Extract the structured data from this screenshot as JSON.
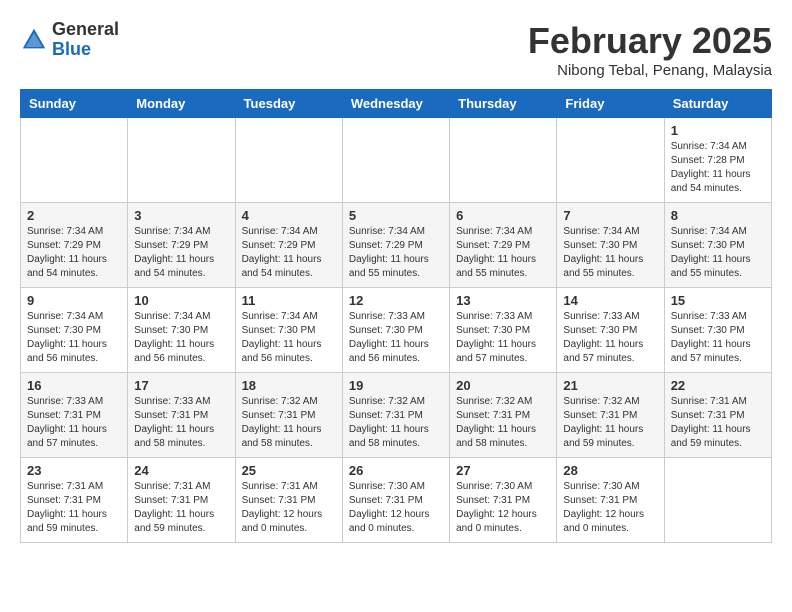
{
  "logo": {
    "general": "General",
    "blue": "Blue"
  },
  "title": "February 2025",
  "location": "Nibong Tebal, Penang, Malaysia",
  "days_of_week": [
    "Sunday",
    "Monday",
    "Tuesday",
    "Wednesday",
    "Thursday",
    "Friday",
    "Saturday"
  ],
  "weeks": [
    [
      {
        "day": "",
        "info": ""
      },
      {
        "day": "",
        "info": ""
      },
      {
        "day": "",
        "info": ""
      },
      {
        "day": "",
        "info": ""
      },
      {
        "day": "",
        "info": ""
      },
      {
        "day": "",
        "info": ""
      },
      {
        "day": "1",
        "info": "Sunrise: 7:34 AM\nSunset: 7:28 PM\nDaylight: 11 hours and 54 minutes."
      }
    ],
    [
      {
        "day": "2",
        "info": "Sunrise: 7:34 AM\nSunset: 7:29 PM\nDaylight: 11 hours and 54 minutes."
      },
      {
        "day": "3",
        "info": "Sunrise: 7:34 AM\nSunset: 7:29 PM\nDaylight: 11 hours and 54 minutes."
      },
      {
        "day": "4",
        "info": "Sunrise: 7:34 AM\nSunset: 7:29 PM\nDaylight: 11 hours and 54 minutes."
      },
      {
        "day": "5",
        "info": "Sunrise: 7:34 AM\nSunset: 7:29 PM\nDaylight: 11 hours and 55 minutes."
      },
      {
        "day": "6",
        "info": "Sunrise: 7:34 AM\nSunset: 7:29 PM\nDaylight: 11 hours and 55 minutes."
      },
      {
        "day": "7",
        "info": "Sunrise: 7:34 AM\nSunset: 7:30 PM\nDaylight: 11 hours and 55 minutes."
      },
      {
        "day": "8",
        "info": "Sunrise: 7:34 AM\nSunset: 7:30 PM\nDaylight: 11 hours and 55 minutes."
      }
    ],
    [
      {
        "day": "9",
        "info": "Sunrise: 7:34 AM\nSunset: 7:30 PM\nDaylight: 11 hours and 56 minutes."
      },
      {
        "day": "10",
        "info": "Sunrise: 7:34 AM\nSunset: 7:30 PM\nDaylight: 11 hours and 56 minutes."
      },
      {
        "day": "11",
        "info": "Sunrise: 7:34 AM\nSunset: 7:30 PM\nDaylight: 11 hours and 56 minutes."
      },
      {
        "day": "12",
        "info": "Sunrise: 7:33 AM\nSunset: 7:30 PM\nDaylight: 11 hours and 56 minutes."
      },
      {
        "day": "13",
        "info": "Sunrise: 7:33 AM\nSunset: 7:30 PM\nDaylight: 11 hours and 57 minutes."
      },
      {
        "day": "14",
        "info": "Sunrise: 7:33 AM\nSunset: 7:30 PM\nDaylight: 11 hours and 57 minutes."
      },
      {
        "day": "15",
        "info": "Sunrise: 7:33 AM\nSunset: 7:30 PM\nDaylight: 11 hours and 57 minutes."
      }
    ],
    [
      {
        "day": "16",
        "info": "Sunrise: 7:33 AM\nSunset: 7:31 PM\nDaylight: 11 hours and 57 minutes."
      },
      {
        "day": "17",
        "info": "Sunrise: 7:33 AM\nSunset: 7:31 PM\nDaylight: 11 hours and 58 minutes."
      },
      {
        "day": "18",
        "info": "Sunrise: 7:32 AM\nSunset: 7:31 PM\nDaylight: 11 hours and 58 minutes."
      },
      {
        "day": "19",
        "info": "Sunrise: 7:32 AM\nSunset: 7:31 PM\nDaylight: 11 hours and 58 minutes."
      },
      {
        "day": "20",
        "info": "Sunrise: 7:32 AM\nSunset: 7:31 PM\nDaylight: 11 hours and 58 minutes."
      },
      {
        "day": "21",
        "info": "Sunrise: 7:32 AM\nSunset: 7:31 PM\nDaylight: 11 hours and 59 minutes."
      },
      {
        "day": "22",
        "info": "Sunrise: 7:31 AM\nSunset: 7:31 PM\nDaylight: 11 hours and 59 minutes."
      }
    ],
    [
      {
        "day": "23",
        "info": "Sunrise: 7:31 AM\nSunset: 7:31 PM\nDaylight: 11 hours and 59 minutes."
      },
      {
        "day": "24",
        "info": "Sunrise: 7:31 AM\nSunset: 7:31 PM\nDaylight: 11 hours and 59 minutes."
      },
      {
        "day": "25",
        "info": "Sunrise: 7:31 AM\nSunset: 7:31 PM\nDaylight: 12 hours and 0 minutes."
      },
      {
        "day": "26",
        "info": "Sunrise: 7:30 AM\nSunset: 7:31 PM\nDaylight: 12 hours and 0 minutes."
      },
      {
        "day": "27",
        "info": "Sunrise: 7:30 AM\nSunset: 7:31 PM\nDaylight: 12 hours and 0 minutes."
      },
      {
        "day": "28",
        "info": "Sunrise: 7:30 AM\nSunset: 7:31 PM\nDaylight: 12 hours and 0 minutes."
      },
      {
        "day": "",
        "info": ""
      }
    ]
  ]
}
